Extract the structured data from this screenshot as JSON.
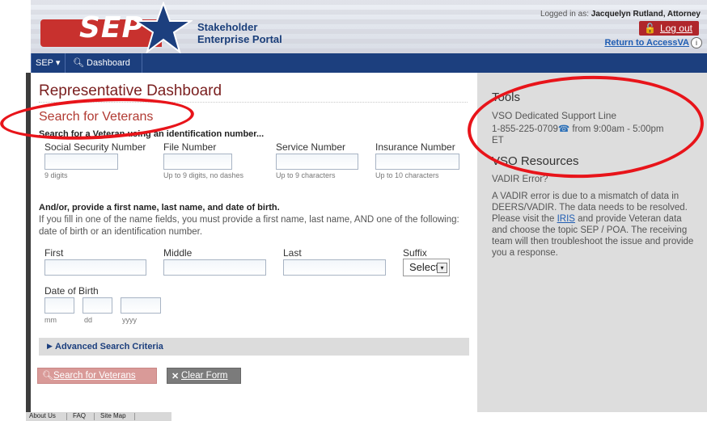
{
  "header": {
    "logo_text": "SEP",
    "portal_title_line1": "Stakeholder",
    "portal_title_line2": "Enterprise Portal",
    "logged_in_prefix": "Logged in as:",
    "logged_in_user": "Jacquelyn Rutland, Attorney",
    "logout_label": "Log out",
    "return_label": "Return to AccessVA",
    "info_glyph": "i"
  },
  "nav": {
    "sep_menu": "SEP ▾",
    "dashboard": "Dashboard"
  },
  "main": {
    "page_title": "Representative Dashboard",
    "section_title": "Search for Veterans",
    "id_instruction": "Search for a Veteran using an identification number...",
    "id_fields": [
      {
        "label": "Social Security Number",
        "hint": "9 digits"
      },
      {
        "label": "File Number",
        "hint": "Up to 9 digits, no dashes"
      },
      {
        "label": "Service Number",
        "hint": "Up to 9 characters"
      },
      {
        "label": "Insurance Number",
        "hint": "Up to 10 characters"
      }
    ],
    "name_instruction": "And/or, provide a first name, last name, and date of birth.",
    "name_paragraph": "If you fill in one of the name fields, you must provide a first name, last name, AND one of the following: date of birth or an identification number.",
    "name_fields": {
      "first": "First",
      "middle": "Middle",
      "last": "Last",
      "suffix": "Suffix",
      "suffix_value": "Select"
    },
    "dob": {
      "label": "Date of Birth",
      "mm": "mm",
      "dd": "dd",
      "yyyy": "yyyy"
    },
    "advanced_label": "Advanced Search Criteria",
    "search_button": "Search for Veterans",
    "clear_button": "Clear Form"
  },
  "sidebar": {
    "tools_title": "Tools",
    "support_line_title": "VSO Dedicated Support Line",
    "support_phone": "1-855-225-0709",
    "support_hours": "from 9:00am - 5:00pm",
    "support_tz": "ET",
    "resources_title": "VSO Resources",
    "vadir_question": "VADIR Error?",
    "vadir_text_1": "A VADIR error is due to a mismatch of data in DEERS/VADIR. The data needs to be resolved. Please visit the",
    "vadir_link": "IRIS",
    "vadir_text_2": "and provide Veteran data and choose the topic SEP / POA. The receiving team will then troubleshoot the issue and provide you a response."
  },
  "footer": {
    "about": "About Us",
    "faq": "FAQ",
    "sitemap": "Site Map"
  },
  "colors": {
    "nav_blue": "#1c3f7e",
    "title_red": "#7a1f1f",
    "logout_red": "#b0262b",
    "annotation_red": "#e8141a",
    "sidebar_gray": "#dddddd"
  }
}
